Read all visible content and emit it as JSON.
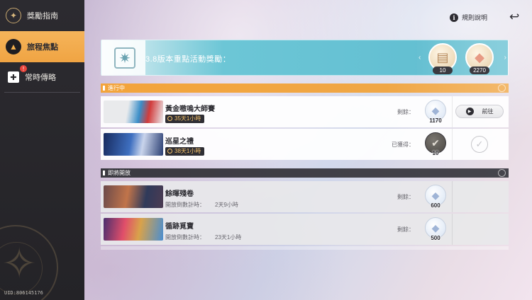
{
  "sidebar": {
    "items": [
      {
        "label": "獎勵指南",
        "icon": "compass-star-icon"
      },
      {
        "label": "旅程焦點",
        "icon": "hat-icon"
      },
      {
        "label": "常時傳略",
        "icon": "plus-square-icon",
        "badge": "!"
      }
    ],
    "uid": "UID:806145176"
  },
  "header": {
    "rules_label": "規則說明",
    "info_icon": "i",
    "back_icon": "↩"
  },
  "banner": {
    "title": "3.8版本重點活動獎勵：",
    "rewards": [
      {
        "icon": "ticket-bundle-icon",
        "count": "10"
      },
      {
        "icon": "crystal-icon",
        "count": "2270"
      }
    ]
  },
  "sections": {
    "ongoing": {
      "title": "進行中",
      "rows": [
        {
          "title": "黃金嗷嗚大師賽",
          "timer": "35天1小時",
          "status_label": "剩餘：",
          "reward_count": "1170",
          "action": "前往",
          "thumb_colors": [
            "#e9eaec",
            "#3a8ec8",
            "#d23b3b"
          ]
        },
        {
          "title": "巡星之禮",
          "timer": "38天1小時",
          "status_label": "已獲得：",
          "reward_count": "10",
          "action": "done",
          "thumb_colors": [
            "#172a5e",
            "#3e6fc0",
            "#c9d4ec"
          ]
        }
      ]
    },
    "upcoming": {
      "title": "即將開放",
      "rows": [
        {
          "title": "餘暉殘卷",
          "countdown_label": "開放倒數計時：",
          "countdown": "2天9小時",
          "status_label": "剩餘：",
          "reward_count": "600",
          "thumb_colors": [
            "#6b4a4a",
            "#c1744a",
            "#2f3a5a"
          ]
        },
        {
          "title": "循跡覓寶",
          "countdown_label": "開放倒數計時：",
          "countdown": "23天1小時",
          "status_label": "剩餘：",
          "reward_count": "500",
          "thumb_colors": [
            "#4a2e6e",
            "#d9a24a",
            "#e04e6a"
          ]
        }
      ]
    }
  },
  "colors": {
    "accent_orange": "#f3a43b",
    "sidebar_bg": "#2c2b30",
    "banner_teal": "#63bfd2",
    "timer_gold": "#f5c26a"
  }
}
